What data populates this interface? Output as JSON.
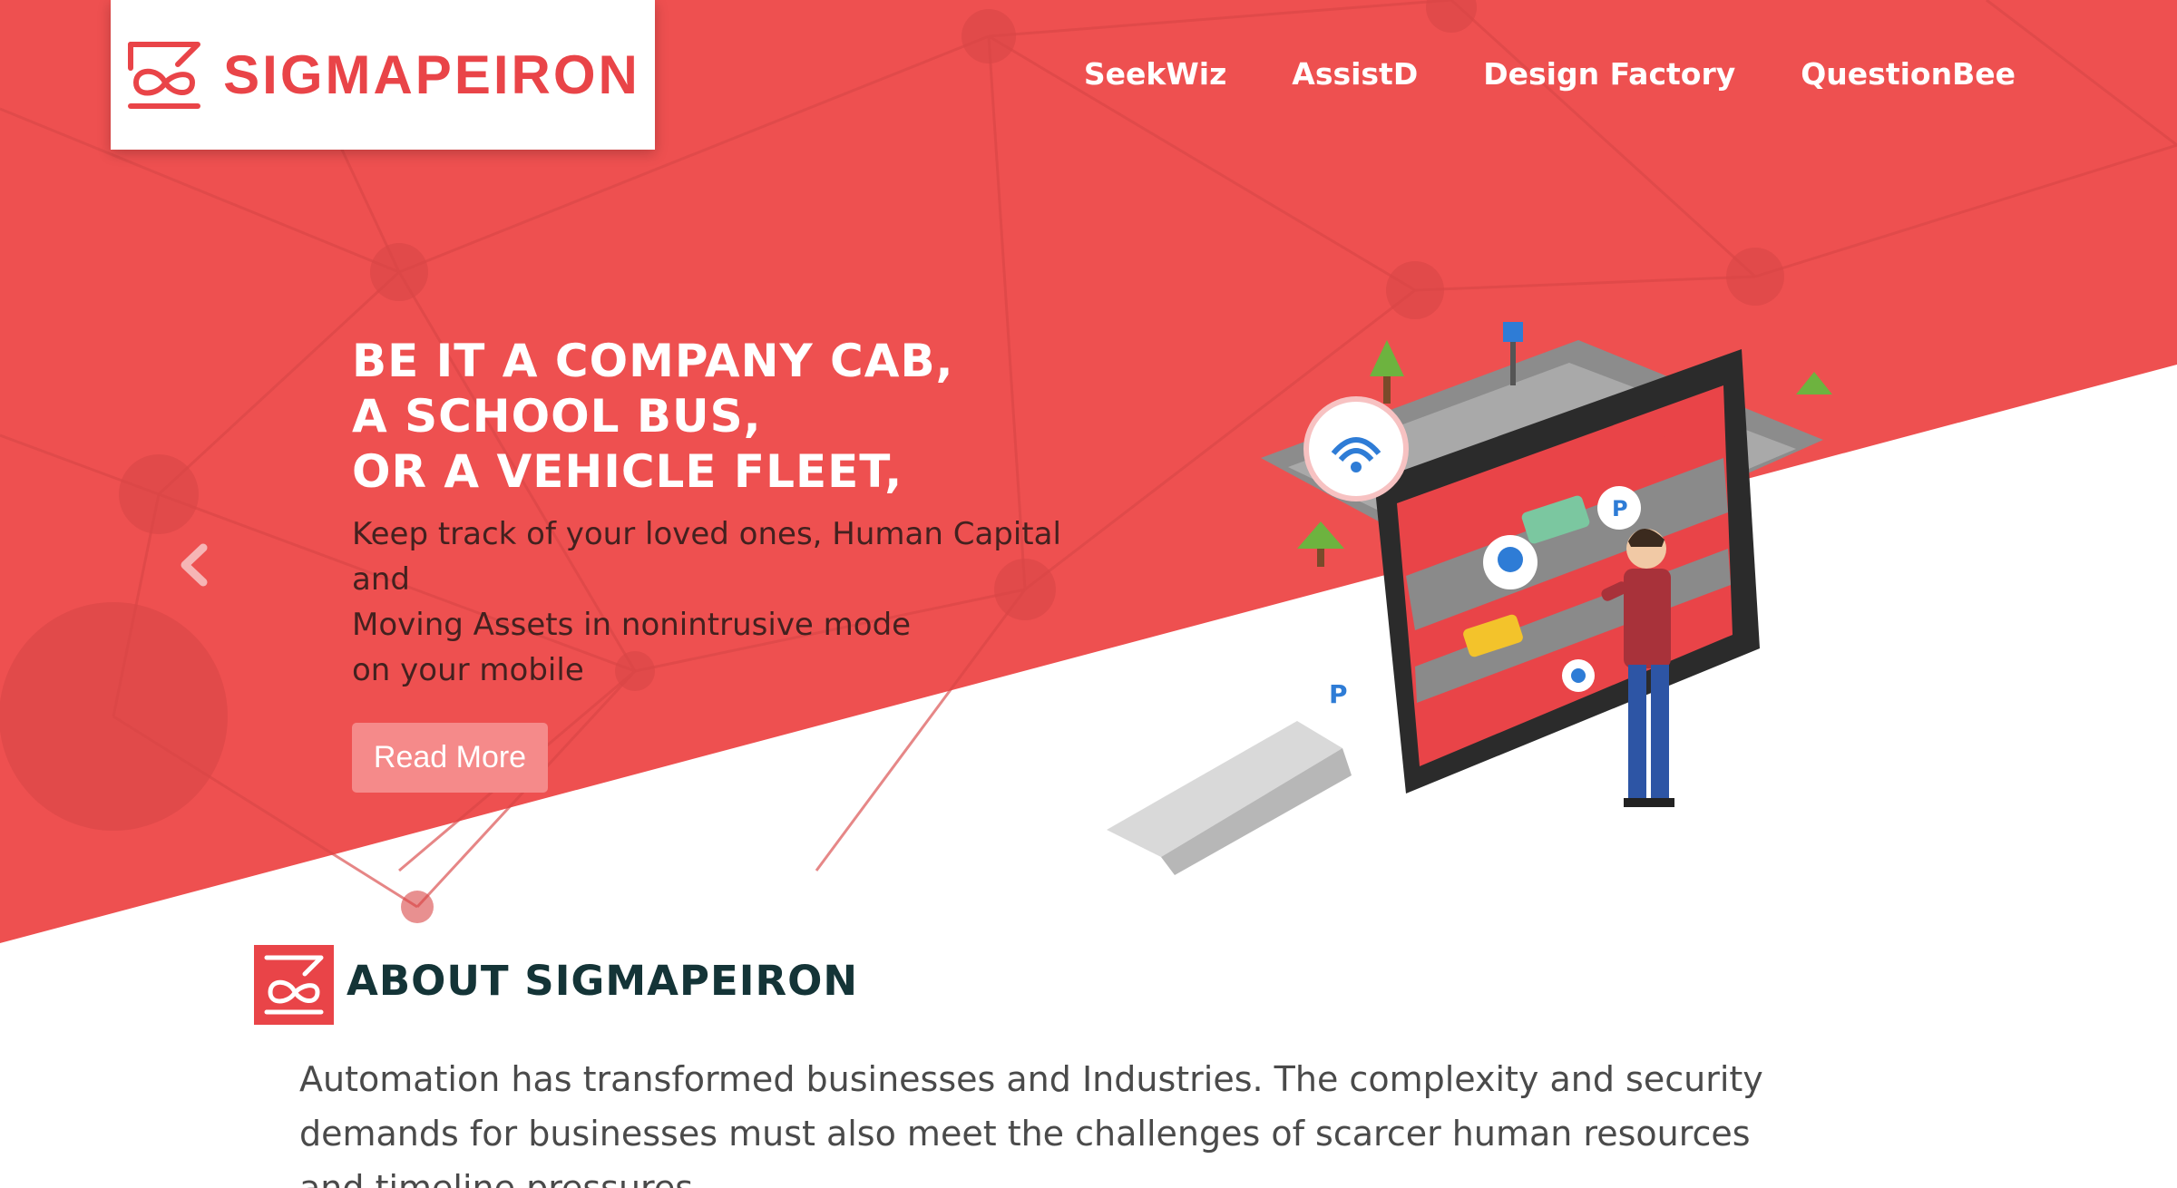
{
  "brand": {
    "name": "SIGMAPEIRON",
    "color": "#e94448"
  },
  "nav": {
    "items": [
      "SeekWiz",
      "AssistD",
      "Design Factory",
      "QuestionBee"
    ]
  },
  "hero": {
    "headline_lines": [
      "BE IT A COMPANY CAB,",
      "A SCHOOL BUS,",
      "OR A VEHICLE FLEET,"
    ],
    "description_lines": [
      "Keep track of your loved ones, Human Capital",
      "and",
      "Moving Assets in nonintrusive mode",
      "on your mobile"
    ],
    "cta_label": "Read More",
    "background_color": "#ee5050",
    "cta_color": "#f58a8a"
  },
  "about": {
    "title": "ABOUT SIGMAPEIRON",
    "body_lines": [
      "Automation has transformed businesses and Industries. The complexity and security",
      "demands for businesses must also meet the challenges of scarcer human resources",
      "and timeline pressures."
    ]
  },
  "icons": {
    "logo": "infinity-logo-icon",
    "carousel_prev": "chevron-left-icon",
    "illustration": "tablet-vehicle-tracking-illustration"
  }
}
